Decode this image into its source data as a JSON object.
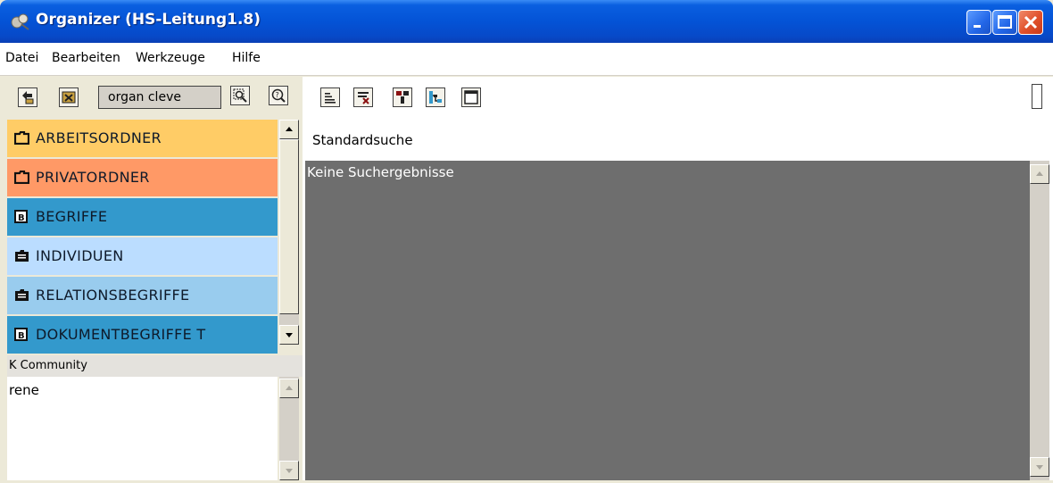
{
  "window": {
    "title": "Organizer (HS-Leitung1.8)",
    "icon": "organizer-app-icon",
    "controls": [
      "minimize-icon",
      "maximize-icon",
      "close-icon"
    ]
  },
  "menu": {
    "items": [
      "Datei",
      "Bearbeiten",
      "Werkzeuge",
      "Hilfe"
    ]
  },
  "left_toolbar": {
    "org_field": "organ cleve",
    "buttons": [
      "back-up-icon",
      "delete-icon",
      "search-zoom-icon",
      "search-help-icon"
    ]
  },
  "folders": [
    {
      "label": "ARBEITSORDNER",
      "icon": "folder-icon",
      "color": "#ffcc66"
    },
    {
      "label": "PRIVATORDNER",
      "icon": "folder-icon",
      "color": "#ff9966"
    },
    {
      "label": "BEGRIFFE",
      "icon": "b-box-icon",
      "color": "#3399cc"
    },
    {
      "label": "INDIVIDUEN",
      "icon": "list-folder-icon",
      "color": "#bbddff"
    },
    {
      "label": "RELATIONSBEGRIFFE",
      "icon": "list-folder-icon",
      "color": "#99ccee"
    },
    {
      "label": "DOKUMENTBEGRIFFE T",
      "icon": "b-box-icon",
      "color": "#3399cc"
    }
  ],
  "community": {
    "header": "K Community",
    "items": [
      "rene"
    ]
  },
  "right_toolbar": {
    "buttons": [
      "list-icon",
      "filter-icon",
      "tree-icon",
      "hierarchy-icon",
      "window-icon"
    ]
  },
  "search": {
    "label": "Standardsuche",
    "results_text": "Keine Suchergebnisse"
  }
}
